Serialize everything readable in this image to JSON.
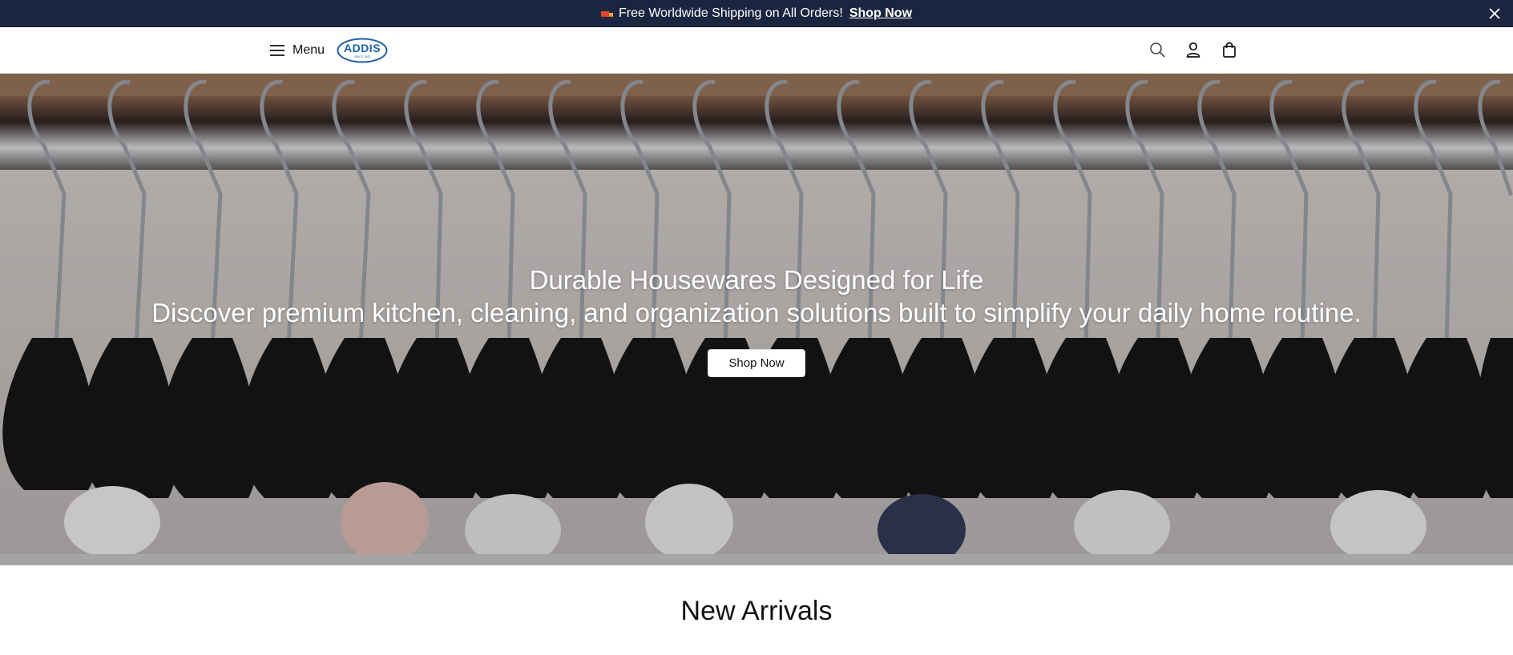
{
  "announcement": {
    "message": "Free Worldwide Shipping on All Orders!",
    "link_label": "Shop Now",
    "icon": "truck-icon"
  },
  "header": {
    "menu_label": "Menu",
    "logo_text": "ADDIS",
    "logo_tagline": "SINCE 1903",
    "icons": [
      "search-icon",
      "account-icon",
      "cart-icon"
    ]
  },
  "hero": {
    "title": "Durable Housewares Designed for Life",
    "subtitle": "Discover premium kitchen, cleaning, and organization solutions built to simplify your daily home routine.",
    "button_label": "Shop Now"
  },
  "new_arrivals": {
    "title": "New Arrivals"
  },
  "colors": {
    "announcement_bg": "#1b2540",
    "logo_blue": "#1f5fa8"
  }
}
